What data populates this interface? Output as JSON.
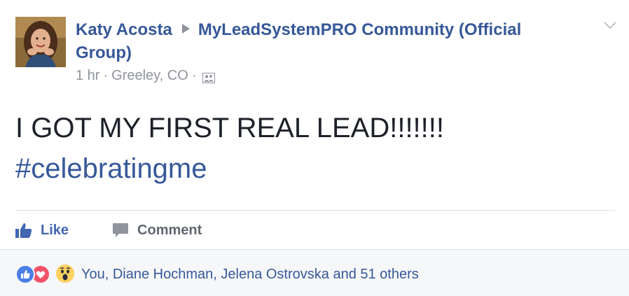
{
  "post": {
    "author": "Katy Acosta",
    "group": "MyLeadSystemPRO Community (Official Group)",
    "time": "1 hr",
    "location": "Greeley, CO",
    "separator": "·",
    "audience_icon": "group-audience-icon",
    "text": "I GOT MY FIRST REAL LEAD!!!!!!!",
    "hashtag": "#celebratingme"
  },
  "actions": {
    "like_label": "Like",
    "comment_label": "Comment"
  },
  "reactions": {
    "icons": [
      "like-reaction-icon",
      "love-reaction-icon",
      "wow-reaction-icon"
    ],
    "summary": "You, Diane Hochman, Jelena Ostrovska and 51 others"
  },
  "colors": {
    "link": "#365899",
    "like_blue": "#4267b2",
    "meta_gray": "#90949c",
    "text": "#1d2129",
    "love_red": "#f25268",
    "wow_yellow": "#fcd15f"
  }
}
